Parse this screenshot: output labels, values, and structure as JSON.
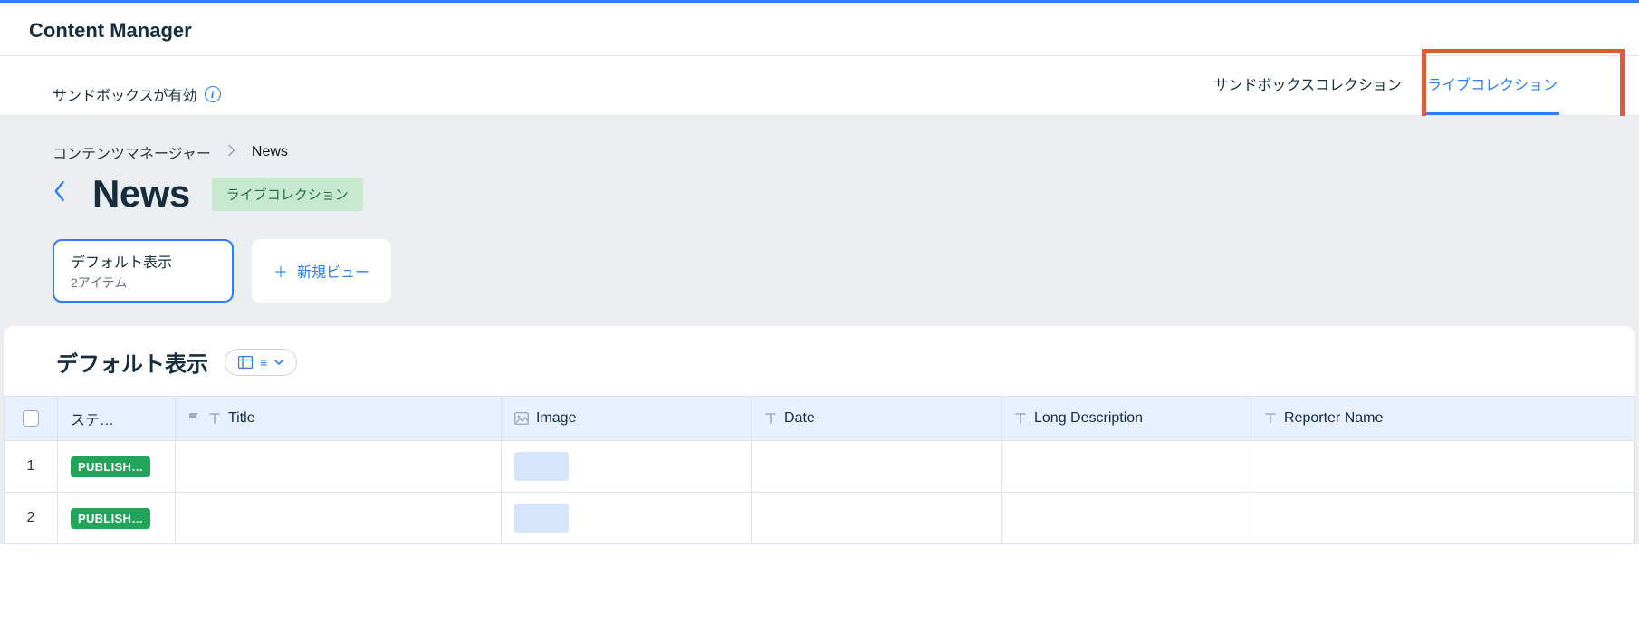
{
  "appTitle": "Content Manager",
  "subBar": {
    "sandboxNotice": "サンドボックスが有効",
    "tabs": {
      "sandbox": "サンドボックスコレクション",
      "live": "ライブコレクション"
    }
  },
  "breadcrumb": {
    "root": "コンテンツマネージャー",
    "current": "News"
  },
  "page": {
    "title": "News",
    "badge": "ライブコレクション"
  },
  "views": {
    "defaultTitle": "デフォルト表示",
    "defaultSub": "2アイテム",
    "newView": "新規ビュー"
  },
  "tableHeader": {
    "title": "デフォルト表示",
    "dropdownGlyph": "≡"
  },
  "columns": {
    "status": "ステ…",
    "title": "Title",
    "image": "Image",
    "date": "Date",
    "longDesc": "Long Description",
    "reporter": "Reporter Name"
  },
  "rows": [
    {
      "idx": "1",
      "status": "PUBLISH…"
    },
    {
      "idx": "2",
      "status": "PUBLISH…"
    }
  ]
}
